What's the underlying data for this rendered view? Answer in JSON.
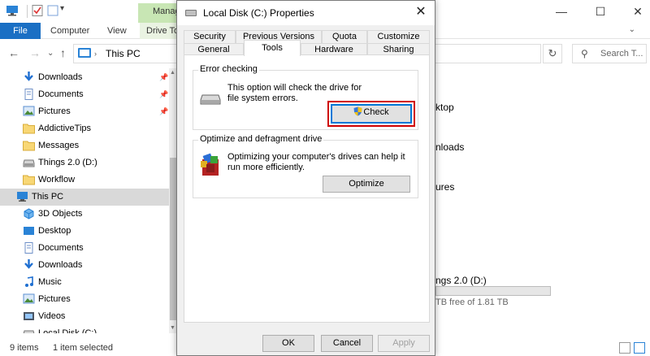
{
  "explorer": {
    "ribbon_tabs": {
      "file": "File",
      "computer": "Computer",
      "view": "View",
      "drive_tools": "Drive To"
    },
    "context_tab": "Manag",
    "address": {
      "location": "This PC",
      "search_placeholder": "Search T..."
    },
    "nav_items": [
      {
        "label": "Downloads",
        "icon": "download-arrow-icon",
        "pinned": true
      },
      {
        "label": "Documents",
        "icon": "document-icon",
        "pinned": true
      },
      {
        "label": "Pictures",
        "icon": "pictures-icon",
        "pinned": true
      },
      {
        "label": "AddictiveTips",
        "icon": "folder-icon",
        "pinned": false
      },
      {
        "label": "Messages",
        "icon": "folder-icon",
        "pinned": false
      },
      {
        "label": "Things 2.0 (D:)",
        "icon": "drive-icon",
        "pinned": false
      },
      {
        "label": "Workflow",
        "icon": "folder-icon",
        "pinned": false
      },
      {
        "label": "This PC",
        "icon": "computer-icon",
        "pinned": false,
        "selected": true
      },
      {
        "label": "3D Objects",
        "icon": "3d-objects-icon",
        "pinned": false
      },
      {
        "label": "Desktop",
        "icon": "desktop-icon",
        "pinned": false
      },
      {
        "label": "Documents",
        "icon": "document-icon",
        "pinned": false
      },
      {
        "label": "Downloads",
        "icon": "download-arrow-icon",
        "pinned": false
      },
      {
        "label": "Music",
        "icon": "music-icon",
        "pinned": false
      },
      {
        "label": "Pictures",
        "icon": "pictures-icon",
        "pinned": false
      },
      {
        "label": "Videos",
        "icon": "videos-icon",
        "pinned": false
      },
      {
        "label": "Local Disk (C:)",
        "icon": "drive-icon",
        "pinned": false
      }
    ],
    "content": {
      "desktop_partial": "ktop",
      "downloads_partial": "nloads",
      "pictures_partial": "ures",
      "drive_name_partial": "ngs 2.0 (D:)",
      "drive_free_partial": "TB free of 1.81 TB"
    },
    "status": {
      "items": "9 items",
      "selected": "1 item selected"
    }
  },
  "dialog": {
    "title": "Local Disk (C:) Properties",
    "tabs_row1": [
      "Security",
      "Previous Versions",
      "Quota",
      "Customize"
    ],
    "tabs_row2": [
      "General",
      "Tools",
      "Hardware",
      "Sharing"
    ],
    "active_tab": "Tools",
    "error_checking": {
      "heading": "Error checking",
      "description": "This option will check the drive for file system errors.",
      "button": "Check"
    },
    "optimize": {
      "heading": "Optimize and defragment drive",
      "description": "Optimizing your computer's drives can help it run more efficiently.",
      "button": "Optimize"
    },
    "buttons": {
      "ok": "OK",
      "cancel": "Cancel",
      "apply": "Apply"
    }
  },
  "colors": {
    "accent": "#0078d7",
    "file_tab": "#1a6fc4",
    "highlight": "#d00000",
    "context_tab": "#c8e6b4"
  }
}
